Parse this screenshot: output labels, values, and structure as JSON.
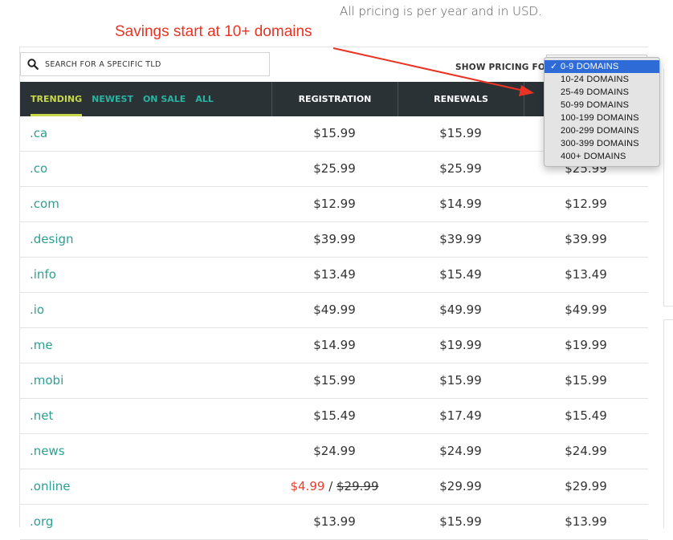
{
  "intro_text": "All pricing is per year and in USD.",
  "annotation_text": "Savings start at 10+ domains",
  "search": {
    "placeholder": "SEARCH FOR A SPECIFIC TLD",
    "value": ""
  },
  "pricing_for_label": "SHOW PRICING FOR",
  "dropdown": {
    "options": [
      "0-9 DOMAINS",
      "10-24 DOMAINS",
      "25-49 DOMAINS",
      "50-99 DOMAINS",
      "100-199 DOMAINS",
      "200-299 DOMAINS",
      "300-399 DOMAINS",
      "400+ DOMAINS"
    ],
    "selected": "0-9 DOMAINS",
    "check": "✓"
  },
  "tabs": [
    "TRENDING",
    "NEWEST",
    "ON SALE",
    "ALL"
  ],
  "active_tab": "TRENDING",
  "columns": {
    "registration": "REGISTRATION",
    "renewals": "RENEWALS"
  },
  "rows": [
    {
      "tld": ".ca",
      "registration": "$15.99",
      "renewals": "$15.99",
      "transfers": ""
    },
    {
      "tld": ".co",
      "registration": "$25.99",
      "renewals": "$25.99",
      "transfers": "$25.99"
    },
    {
      "tld": ".com",
      "registration": "$12.99",
      "renewals": "$14.99",
      "transfers": "$12.99"
    },
    {
      "tld": ".design",
      "registration": "$39.99",
      "renewals": "$39.99",
      "transfers": "$39.99"
    },
    {
      "tld": ".info",
      "registration": "$13.49",
      "renewals": "$15.49",
      "transfers": "$13.49"
    },
    {
      "tld": ".io",
      "registration": "$49.99",
      "renewals": "$49.99",
      "transfers": "$49.99"
    },
    {
      "tld": ".me",
      "registration": "$14.99",
      "renewals": "$19.99",
      "transfers": "$19.99"
    },
    {
      "tld": ".mobi",
      "registration": "$15.99",
      "renewals": "$15.99",
      "transfers": "$15.99"
    },
    {
      "tld": ".net",
      "registration": "$15.49",
      "renewals": "$17.49",
      "transfers": "$15.49"
    },
    {
      "tld": ".news",
      "registration": "$24.99",
      "renewals": "$24.99",
      "transfers": "$24.99"
    },
    {
      "tld": ".online",
      "registration": "$4.99",
      "registration_old": "$29.99",
      "renewals": "$29.99",
      "transfers": "$29.99"
    },
    {
      "tld": ".org",
      "registration": "$13.99",
      "renewals": "$15.99",
      "transfers": "$13.99"
    }
  ],
  "colors": {
    "accent_teal": "#2ab3a0",
    "active_tab": "#c8d84a",
    "header_bg": "#2b3236",
    "sale_red": "#ea3f2e",
    "annotation_red": "#ea3323",
    "selected_option": "#2f6bd6"
  },
  "icons": {
    "search": "magnifier-icon",
    "check": "checkmark-icon",
    "arrow": "red-arrow-annotation"
  }
}
